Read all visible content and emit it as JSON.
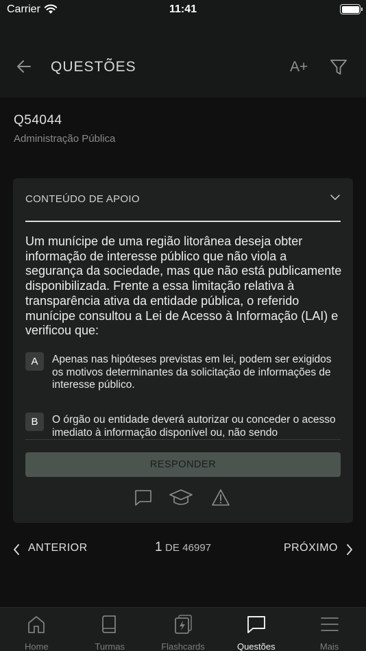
{
  "status_bar": {
    "carrier": "Carrier",
    "time": "11:41"
  },
  "header": {
    "title": "QUESTÕES",
    "font_size_label": "A+"
  },
  "question": {
    "id": "Q54044",
    "subject": "Administração Pública",
    "support_label": "CONTEÚDO DE APOIO",
    "text": "Um munícipe de uma região litorânea deseja obter informação de interesse público que não viola a segurança da sociedade, mas que não está publicamente disponibilizada. Frente a essa limitação relativa à transparência ativa da entidade pública, o referido munícipe consultou a Lei de Acesso à Informação (LAI) e verificou que:",
    "options": [
      {
        "letter": "A",
        "text": "Apenas nas hipóteses previstas em lei, podem ser exigidos os motivos determinantes da solicitação de informações de interesse público."
      },
      {
        "letter": "B",
        "text": "O órgão ou entidade deverá autorizar ou conceder o acesso imediato à informação disponível ou, não sendo"
      }
    ],
    "answer_button": "RESPONDER"
  },
  "navigation": {
    "prev_label": "ANTERIOR",
    "current": "1",
    "of_label": "DE",
    "total": "46997",
    "next_label": "PRÓXIMO"
  },
  "tab_bar": {
    "tabs": [
      {
        "label": "Home",
        "icon": "home-icon"
      },
      {
        "label": "Turmas",
        "icon": "book-icon"
      },
      {
        "label": "Flashcards",
        "icon": "flashcards-icon"
      },
      {
        "label": "Questões",
        "icon": "chat-bubble-icon"
      },
      {
        "label": "Mais",
        "icon": "menu-icon"
      }
    ],
    "active": "Questões"
  },
  "colors": {
    "background": "#101010",
    "surface": "#1f2120",
    "header": "#171918",
    "button": "#4c5450"
  }
}
